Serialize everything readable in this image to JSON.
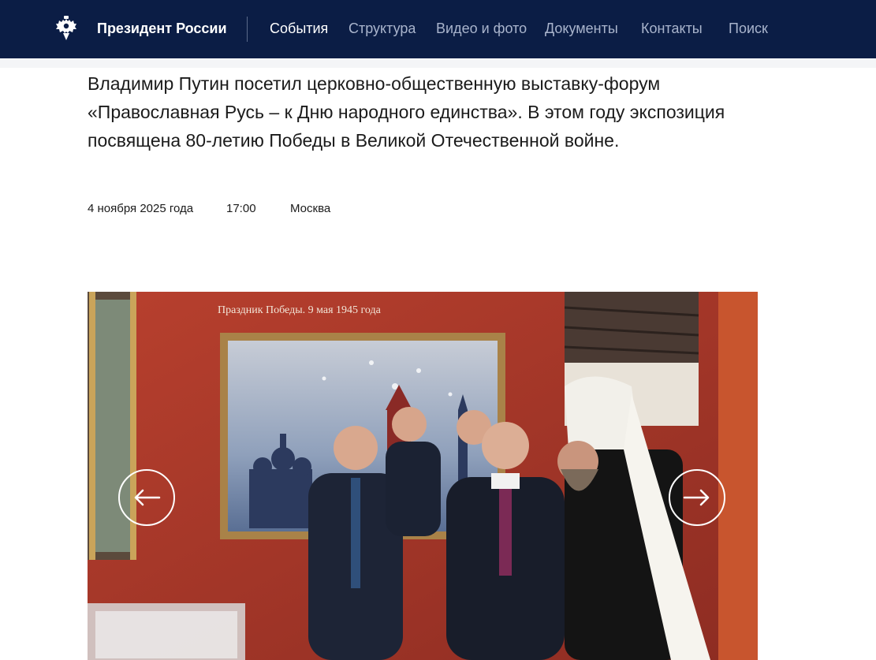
{
  "header": {
    "brand": "Президент России",
    "nav": [
      {
        "label": "События",
        "active": true
      },
      {
        "label": "Структура",
        "active": false
      },
      {
        "label": "Видео и фото",
        "active": false
      },
      {
        "label": "Документы",
        "active": false
      },
      {
        "label": "Контакты",
        "active": false
      },
      {
        "label": "Поиск",
        "active": false
      }
    ],
    "background": "#0b1d45"
  },
  "article": {
    "lead": "Владимир Путин посетил церковно-общественную выставку-форум «Православная Русь – к Дню народного единства». В этом году экспозиция посвящена 80-летию Победы в Великой Отечественной войне.",
    "date": "4 ноября 2025 года",
    "time": "17:00",
    "place": "Москва"
  },
  "gallery": {
    "painting_caption": "Праздник Победы. 9 мая 1945 года",
    "prev_icon": "arrow-left-icon",
    "next_icon": "arrow-right-icon"
  }
}
